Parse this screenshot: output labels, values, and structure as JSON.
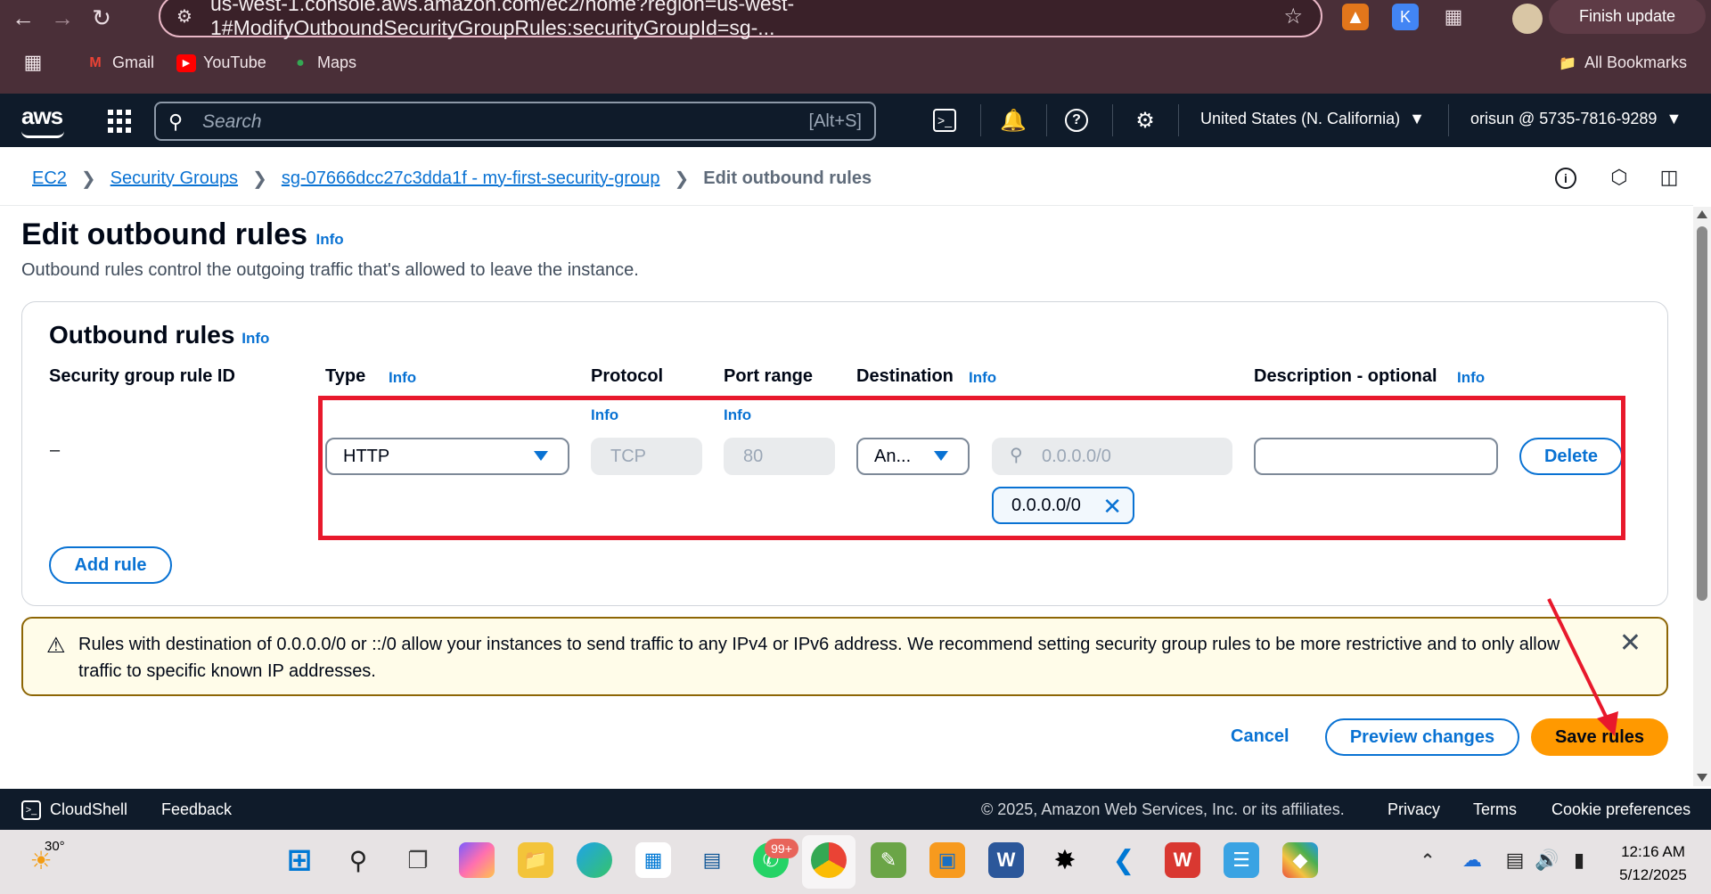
{
  "browser": {
    "url": "us-west-1.console.aws.amazon.com/ec2/home?region=us-west-1#ModifyOutboundSecurityGroupRules:securityGroupId=sg-...",
    "finish_update": "Finish update",
    "bookmarks": [
      {
        "label": "Gmail",
        "icon": "gmail-icon"
      },
      {
        "label": "YouTube",
        "icon": "youtube-icon"
      },
      {
        "label": "Maps",
        "icon": "maps-icon"
      }
    ],
    "all_bookmarks": "All Bookmarks"
  },
  "aws_header": {
    "logo": "aws",
    "search_placeholder": "Search",
    "search_shortcut": "[Alt+S]",
    "region": "United States (N. California)",
    "account": "orisun @ 5735-7816-9289"
  },
  "breadcrumb": {
    "items": [
      "EC2",
      "Security Groups",
      "sg-07666dcc27c3dda1f - my-first-security-group"
    ],
    "current": "Edit outbound rules"
  },
  "page": {
    "title": "Edit outbound rules",
    "info": "Info",
    "description": "Outbound rules control the outgoing traffic that's allowed to leave the instance."
  },
  "rules": {
    "section_title": "Outbound rules",
    "columns": {
      "rule_id": "Security group rule ID",
      "type": "Type",
      "protocol": "Protocol",
      "port_range": "Port range",
      "destination": "Destination",
      "description": "Description - optional"
    },
    "info": "Info",
    "row": {
      "rule_id": "–",
      "type": "HTTP",
      "protocol": "TCP",
      "port_range": "80",
      "destination_type": "An...",
      "destination_search_placeholder": "0.0.0.0/0",
      "destination_token": "0.0.0.0/0",
      "description": "",
      "delete": "Delete"
    },
    "add_rule": "Add rule"
  },
  "warning": {
    "text": "Rules with destination of 0.0.0.0/0 or ::/0 allow your instances to send traffic to any IPv4 or IPv6 address. We recommend setting security group rules to be more restrictive and to only allow traffic to specific known IP addresses."
  },
  "actions": {
    "cancel": "Cancel",
    "preview": "Preview changes",
    "save": "Save rules"
  },
  "footer": {
    "cloudshell": "CloudShell",
    "feedback": "Feedback",
    "copyright": "© 2025, Amazon Web Services, Inc. or its affiliates.",
    "privacy": "Privacy",
    "terms": "Terms",
    "cookies": "Cookie preferences"
  },
  "taskbar": {
    "weather": "30°",
    "badge": "99+",
    "time": "12:16 AM",
    "date": "5/12/2025"
  },
  "colors": {
    "aws_nav": "#0f1b2a",
    "link": "#0972d3",
    "primary": "#ff9900",
    "highlight": "#e8192c",
    "browser_chrome": "#4a2f38"
  }
}
